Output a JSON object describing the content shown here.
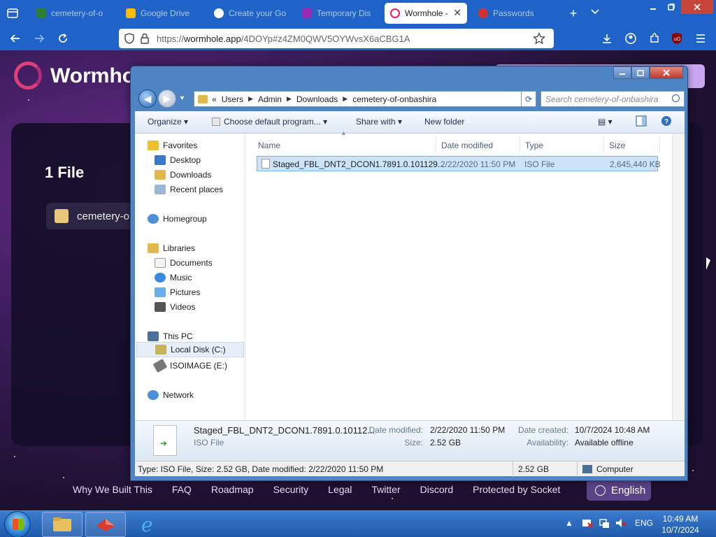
{
  "browser": {
    "tabs": [
      {
        "label": "cemetery-of-o",
        "color": "#2e7d32"
      },
      {
        "label": "Google Drive",
        "color": "#fbbc04"
      },
      {
        "label": "Create your Go",
        "color": "#4285f4"
      },
      {
        "label": "Temporary Dis",
        "color": "#9c27b0"
      },
      {
        "label": "Wormhole -",
        "color": "#e91e63"
      },
      {
        "label": "Passwords",
        "color": "#d32f2f"
      }
    ],
    "url_prefix": "https://",
    "url_host": "wormhole.app",
    "url_path": "/4DOYp#z4ZM0QWV5OYWvsX6aCBG1A",
    "tab_close": "✕"
  },
  "wormhole": {
    "brand": "Wormhole",
    "file_count": "1 File",
    "file_name": "cemetery-o",
    "footer_links": [
      "Why We Built This",
      "FAQ",
      "Roadmap",
      "Security",
      "Legal",
      "Twitter",
      "Discord",
      "Protected by Socket"
    ],
    "language": "English"
  },
  "explorer": {
    "breadcrumbs": [
      "Users",
      "Admin",
      "Downloads",
      "cemetery-of-onbashira"
    ],
    "breadcrumb_prefix": "«",
    "search_placeholder": "Search cemetery-of-onbashira",
    "toolbar": {
      "organize": "Organize",
      "choose_default": "Choose default program...",
      "share_with": "Share with",
      "new_folder": "New folder"
    },
    "nav": {
      "favorites": "Favorites",
      "desktop": "Desktop",
      "downloads": "Downloads",
      "recent": "Recent places",
      "homegroup": "Homegroup",
      "libraries": "Libraries",
      "documents": "Documents",
      "music": "Music",
      "pictures": "Pictures",
      "videos": "Videos",
      "this_pc": "This PC",
      "local_disk": "Local Disk (C:)",
      "isoimage": "ISOIMAGE (E:)",
      "network": "Network"
    },
    "columns": {
      "name": "Name",
      "date_modified": "Date modified",
      "type": "Type",
      "size": "Size"
    },
    "file": {
      "name": "Staged_FBL_DNT2_DCON1.7891.0.101129...",
      "date_modified": "2/22/2020 11:50 PM",
      "type": "ISO File",
      "size": "2,645,440 KB"
    },
    "details": {
      "name": "Staged_FBL_DNT2_DCON1.7891.0.10112...",
      "type": "ISO File",
      "date_modified_label": "Date modified:",
      "date_modified": "2/22/2020 11:50 PM",
      "size_label": "Size:",
      "size": "2.52 GB",
      "date_created_label": "Date created:",
      "date_created": "10/7/2024 10:48 AM",
      "availability_label": "Availability:",
      "availability": "Available offline"
    },
    "status": {
      "summary": "Type: ISO File, Size: 2.52 GB, Date modified: 2/22/2020 11:50 PM",
      "size": "2.52 GB",
      "location": "Computer"
    }
  },
  "taskbar": {
    "language": "ENG",
    "time": "10:49 AM",
    "date": "10/7/2024"
  }
}
